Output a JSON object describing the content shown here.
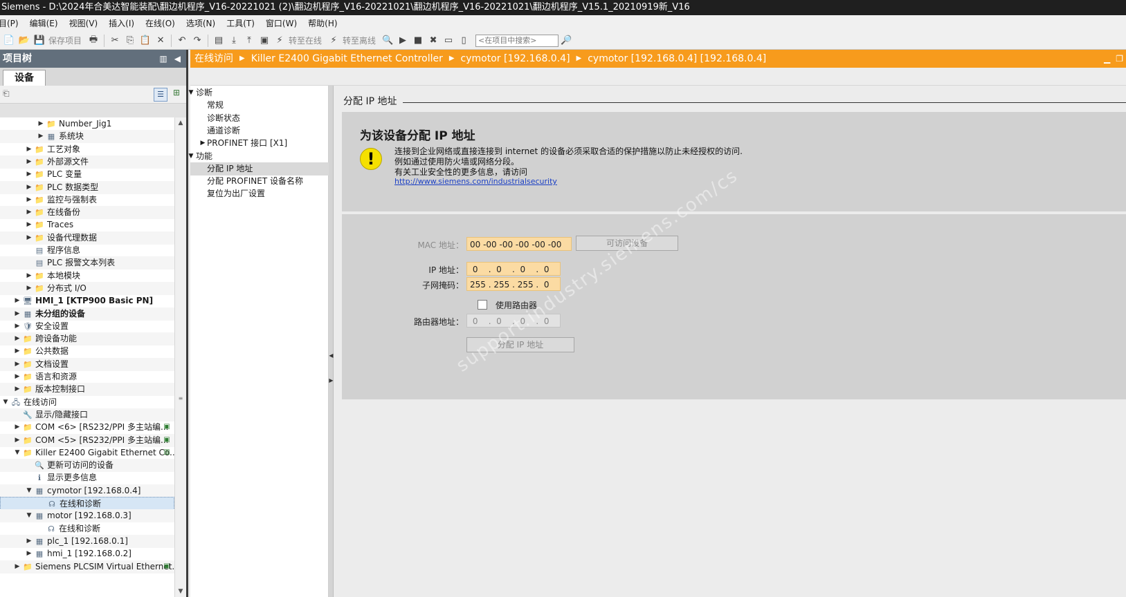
{
  "window": {
    "title": "Siemens  -  D:\\2024年合美达智能装配\\翻边机程序_V16-20221021 (2)\\翻边机程序_V16-20221021\\翻边机程序_V16-20221021\\翻边机程序_V15.1_20210919新_V16"
  },
  "menu": {
    "items": [
      "目(P)",
      "编辑(E)",
      "视图(V)",
      "插入(I)",
      "在线(O)",
      "选项(N)",
      "工具(T)",
      "窗口(W)",
      "帮助(H)"
    ]
  },
  "toolbar": {
    "save_project": "保存项目",
    "go_online": "转至在线",
    "go_offline": "转至离线",
    "search_placeholder": "<在项目中搜索>"
  },
  "project_tree": {
    "header": "项目树",
    "tab": "设备",
    "rows": [
      {
        "label": "Number_Jig1",
        "level": 3,
        "expander": "▶",
        "icon": "📁"
      },
      {
        "label": "系统块",
        "level": 3,
        "expander": "▶",
        "icon": "▦"
      },
      {
        "label": "工艺对象",
        "level": 2,
        "expander": "▶",
        "icon": "📁"
      },
      {
        "label": "外部源文件",
        "level": 2,
        "expander": "▶",
        "icon": "📁"
      },
      {
        "label": "PLC 变量",
        "level": 2,
        "expander": "▶",
        "icon": "📁"
      },
      {
        "label": "PLC 数据类型",
        "level": 2,
        "expander": "▶",
        "icon": "📁"
      },
      {
        "label": "监控与强制表",
        "level": 2,
        "expander": "▶",
        "icon": "📁"
      },
      {
        "label": "在线备份",
        "level": 2,
        "expander": "▶",
        "icon": "📁"
      },
      {
        "label": "Traces",
        "level": 2,
        "expander": "▶",
        "icon": "📁"
      },
      {
        "label": "设备代理数据",
        "level": 2,
        "expander": "▶",
        "icon": "📁"
      },
      {
        "label": "程序信息",
        "level": 2,
        "expander": "",
        "icon": "▤"
      },
      {
        "label": "PLC 报警文本列表",
        "level": 2,
        "expander": "",
        "icon": "▤"
      },
      {
        "label": "本地模块",
        "level": 2,
        "expander": "▶",
        "icon": "📁"
      },
      {
        "label": "分布式 I/O",
        "level": 2,
        "expander": "▶",
        "icon": "📁"
      },
      {
        "label": "HMI_1 [KTP900 Basic PN]",
        "level": 1,
        "expander": "▶",
        "icon": "🖥",
        "bold": true
      },
      {
        "label": "未分组的设备",
        "level": 1,
        "expander": "▶",
        "icon": "▦",
        "bold": true
      },
      {
        "label": "安全设置",
        "level": 1,
        "expander": "▶",
        "icon": "🛡"
      },
      {
        "label": "跨设备功能",
        "level": 1,
        "expander": "▶",
        "icon": "📁"
      },
      {
        "label": "公共数据",
        "level": 1,
        "expander": "▶",
        "icon": "📁"
      },
      {
        "label": "文档设置",
        "level": 1,
        "expander": "▶",
        "icon": "📁"
      },
      {
        "label": "语言和资源",
        "level": 1,
        "expander": "▶",
        "icon": "📁"
      },
      {
        "label": "版本控制接口",
        "level": 1,
        "expander": "▶",
        "icon": "📁"
      },
      {
        "label": "在线访问",
        "level": 0,
        "expander": "▼",
        "icon": "🖧"
      },
      {
        "label": "显示/隐藏接口",
        "level": 1,
        "expander": "",
        "icon": "🔧"
      },
      {
        "label": "COM <6> [RS232/PPI 多主站编...",
        "level": 1,
        "expander": "▶",
        "icon": "📁",
        "tail": "▣"
      },
      {
        "label": "COM <5> [RS232/PPI 多主站编...",
        "level": 1,
        "expander": "▶",
        "icon": "📁",
        "tail": "▣"
      },
      {
        "label": "Killer E2400 Gigabit Ethernet Co...",
        "level": 1,
        "expander": "▼",
        "icon": "📁",
        "tail": "▥"
      },
      {
        "label": "更新可访问的设备",
        "level": 2,
        "expander": "",
        "icon": "🔍"
      },
      {
        "label": "显示更多信息",
        "level": 2,
        "expander": "",
        "icon": "ℹ"
      },
      {
        "label": "cymotor [192.168.0.4]",
        "level": 2,
        "expander": "▼",
        "icon": "▦"
      },
      {
        "label": "在线和诊断",
        "level": 3,
        "expander": "",
        "icon": "☊",
        "selected": true
      },
      {
        "label": "motor [192.168.0.3]",
        "level": 2,
        "expander": "▼",
        "icon": "▦"
      },
      {
        "label": "在线和诊断",
        "level": 3,
        "expander": "",
        "icon": "☊"
      },
      {
        "label": "plc_1 [192.168.0.1]",
        "level": 2,
        "expander": "▶",
        "icon": "▦"
      },
      {
        "label": "hmi_1 [192.168.0.2]",
        "level": 2,
        "expander": "▶",
        "icon": "▦"
      },
      {
        "label": "Siemens PLCSIM Virtual Ethernet...",
        "level": 1,
        "expander": "▶",
        "icon": "📁",
        "tail": "▣"
      }
    ]
  },
  "breadcrumb": {
    "items": [
      "在线访问",
      "Killer E2400 Gigabit Ethernet Controller",
      "cymotor [192.168.0.4]",
      "cymotor [192.168.0.4] [192.168.0.4]"
    ]
  },
  "nav": {
    "rows": [
      {
        "label": "诊断",
        "indent": 0,
        "expander": "▼"
      },
      {
        "label": "常规",
        "indent": 1,
        "expander": ""
      },
      {
        "label": "诊断状态",
        "indent": 1,
        "expander": ""
      },
      {
        "label": "通道诊断",
        "indent": 1,
        "expander": ""
      },
      {
        "label": "PROFINET 接口 [X1]",
        "indent": 1,
        "expander": "▶"
      },
      {
        "label": "功能",
        "indent": 0,
        "expander": "▼"
      },
      {
        "label": "分配 IP 地址",
        "indent": 1,
        "expander": "",
        "selected": true
      },
      {
        "label": "分配 PROFINET 设备名称",
        "indent": 1,
        "expander": ""
      },
      {
        "label": "复位为出厂设置",
        "indent": 1,
        "expander": ""
      }
    ]
  },
  "content": {
    "section_title": "分配 IP 地址",
    "heading": "为该设备分配 IP 地址",
    "warning_lines": [
      "连接到企业网络或直接连接到 internet 的设备必须采取合适的保护措施以防止未经授权的访问.",
      "例如通过使用防火墙或网络分段。",
      "有关工业安全性的更多信息，请访问"
    ],
    "link": "http://www.siemens.com/industrialsecurity",
    "form": {
      "mac_label": "MAC 地址：",
      "mac_value": "00 -00 -00 -00 -00 -00",
      "accessible_devices_button": "可访问设备",
      "ip_label": "IP 地址：",
      "ip_value": " 0    .  0    .  0    .  0",
      "subnet_label": "子网掩码：",
      "subnet_value": "255 . 255 . 255 .  0",
      "use_router_label": "使用路由器",
      "use_router_checked": false,
      "router_label": "路由器地址：",
      "router_value": " 0    .  0    .  0    .  0",
      "assign_button": "分配 IP 地址"
    },
    "watermark": "support.industry.siemens.com/cs"
  }
}
